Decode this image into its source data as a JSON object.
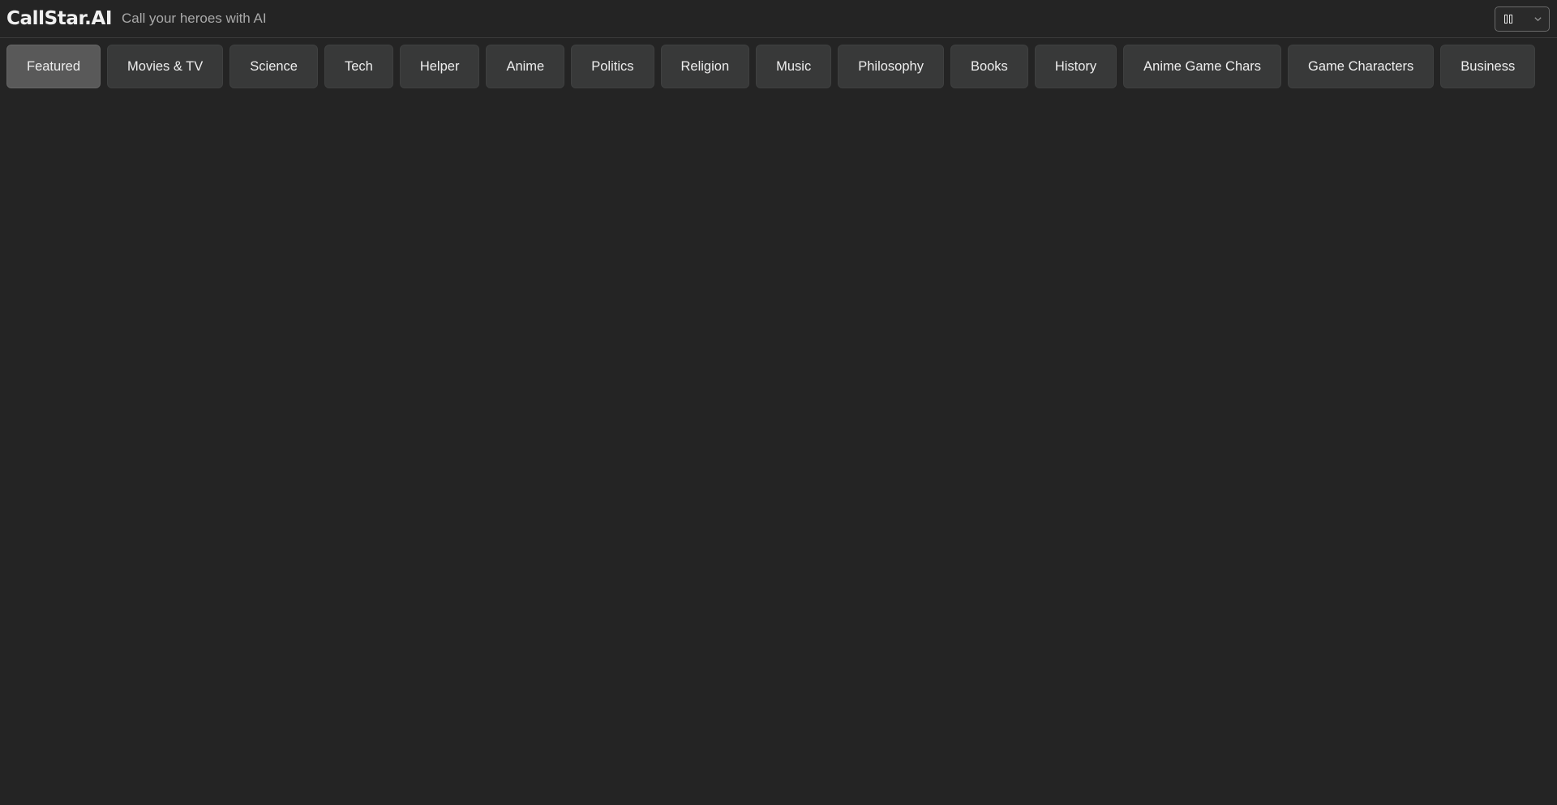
{
  "header": {
    "brand": "CallStar.AI",
    "tagline": "Call your heroes with AI",
    "language_select": {
      "icon": "flag-icon",
      "chevron_icon": "chevron-down-icon"
    }
  },
  "tabs": [
    {
      "label": "Featured",
      "active": true
    },
    {
      "label": "Movies & TV",
      "active": false
    },
    {
      "label": "Science",
      "active": false
    },
    {
      "label": "Tech",
      "active": false
    },
    {
      "label": "Helper",
      "active": false
    },
    {
      "label": "Anime",
      "active": false
    },
    {
      "label": "Politics",
      "active": false
    },
    {
      "label": "Religion",
      "active": false
    },
    {
      "label": "Music",
      "active": false
    },
    {
      "label": "Philosophy",
      "active": false
    },
    {
      "label": "Books",
      "active": false
    },
    {
      "label": "History",
      "active": false
    },
    {
      "label": "Anime Game Chars",
      "active": false
    },
    {
      "label": "Game Characters",
      "active": false
    },
    {
      "label": "Business",
      "active": false
    }
  ],
  "colors": {
    "background": "#242424",
    "tab_background": "#383939",
    "tab_active_background": "#595959"
  }
}
